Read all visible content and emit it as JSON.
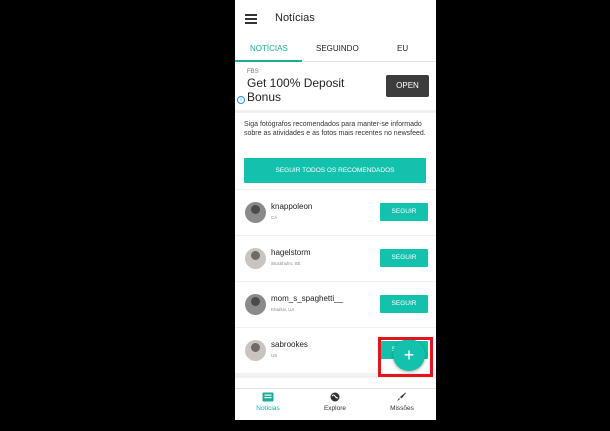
{
  "app": {
    "title": "Notícias"
  },
  "tabs": [
    {
      "label": "NOTÍCIAS",
      "active": true
    },
    {
      "label": "SEGUINDO",
      "active": false
    },
    {
      "label": "EU",
      "active": false
    }
  ],
  "ad": {
    "source": "FBS",
    "headline": "Get 100% Deposit Bonus",
    "cta": "OPEN"
  },
  "recommendation": {
    "text": "Siga fotógrafos recomendados para manter-se informado sobre as atividades e as fotos mais recentes no newsfeed.",
    "follow_all_label": "SEGUIR TODOS OS RECOMENDADOS"
  },
  "users": [
    {
      "name": "knappoleon",
      "location": "CA",
      "button": "SEGUIR"
    },
    {
      "name": "hagelstorm",
      "location": "Stockholm, SE",
      "button": "SEGUIR"
    },
    {
      "name": "mom_s_spaghetti__",
      "location": "Kharkiv, UA",
      "button": "SEGUIR"
    },
    {
      "name": "sabrookes",
      "location": "US",
      "button": "SEGUIR"
    }
  ],
  "bottom_nav": [
    {
      "label": "Notícias",
      "icon": "news-icon",
      "active": true
    },
    {
      "label": "Explore",
      "icon": "globe-icon",
      "active": false
    },
    {
      "label": "Missões",
      "icon": "rocket-icon",
      "active": false
    }
  ],
  "fab": {
    "icon": "plus-icon",
    "symbol": "+"
  },
  "colors": {
    "accent": "#13c2ad",
    "highlight": "#e4141d"
  }
}
